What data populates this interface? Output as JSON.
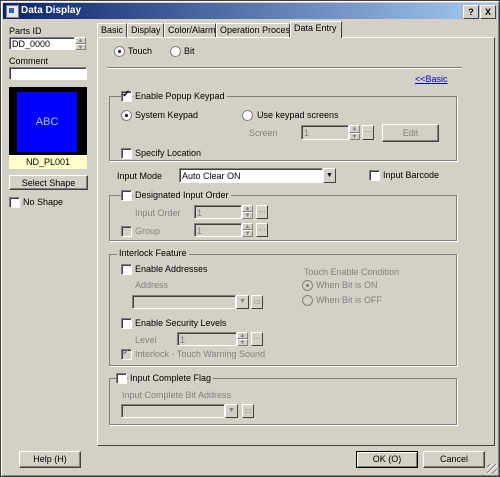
{
  "window": {
    "title": "Data Display",
    "help_label": "?",
    "close_label": "X"
  },
  "left": {
    "parts_id_label": "Parts ID",
    "parts_id_value": "DD_0000",
    "comment_label": "Comment",
    "comment_value": "",
    "preview_text": "ABC",
    "preview_name": "ND_PL001",
    "select_shape_label": "Select Shape",
    "no_shape_label": "No Shape"
  },
  "tabs": [
    "Basic",
    "Display",
    "Color/Alarm",
    "Operation Process",
    "Data Entry"
  ],
  "data_entry": {
    "touch_label": "Touch",
    "bit_label": "Bit",
    "basic_link": "<<Basic",
    "popup": {
      "enable_label": "Enable Popup Keypad",
      "system_keypad_label": "System Keypad",
      "use_keypad_screens_label": "Use keypad screens",
      "screen_label": "Screen",
      "screen_value": "1",
      "edit_label": "Edit",
      "specify_location_label": "Specify Location"
    },
    "input_mode_label": "Input Mode",
    "input_mode_value": "Auto Clear ON",
    "input_barcode_label": "Input Barcode",
    "designated": {
      "label": "Designated Input Order",
      "input_order_label": "Input Order",
      "input_order_value": "1",
      "group_label": "Group",
      "group_value": "1"
    },
    "interlock": {
      "title": "Interlock Feature",
      "enable_addresses_label": "Enable Addresses",
      "address_label": "Address",
      "touch_enable_condition_label": "Touch Enable Condition",
      "when_on_label": "When Bit is ON",
      "when_off_label": "When Bit is OFF",
      "enable_security_label": "Enable Security Levels",
      "level_label": "Level",
      "level_value": "1",
      "warning_sound_label": "Interlock - Touch Warning Sound"
    },
    "complete": {
      "label": "Input Complete Flag",
      "bit_address_label": "Input Complete Bit Address"
    }
  },
  "footer": {
    "help_label": "Help (H)",
    "ok_label": "OK (O)",
    "cancel_label": "Cancel"
  },
  "colors": {
    "title_start": "#0a246a",
    "title_end": "#a6caf0",
    "preview_bg": "#0000ff",
    "preview_label_bg": "#ffffcc"
  }
}
